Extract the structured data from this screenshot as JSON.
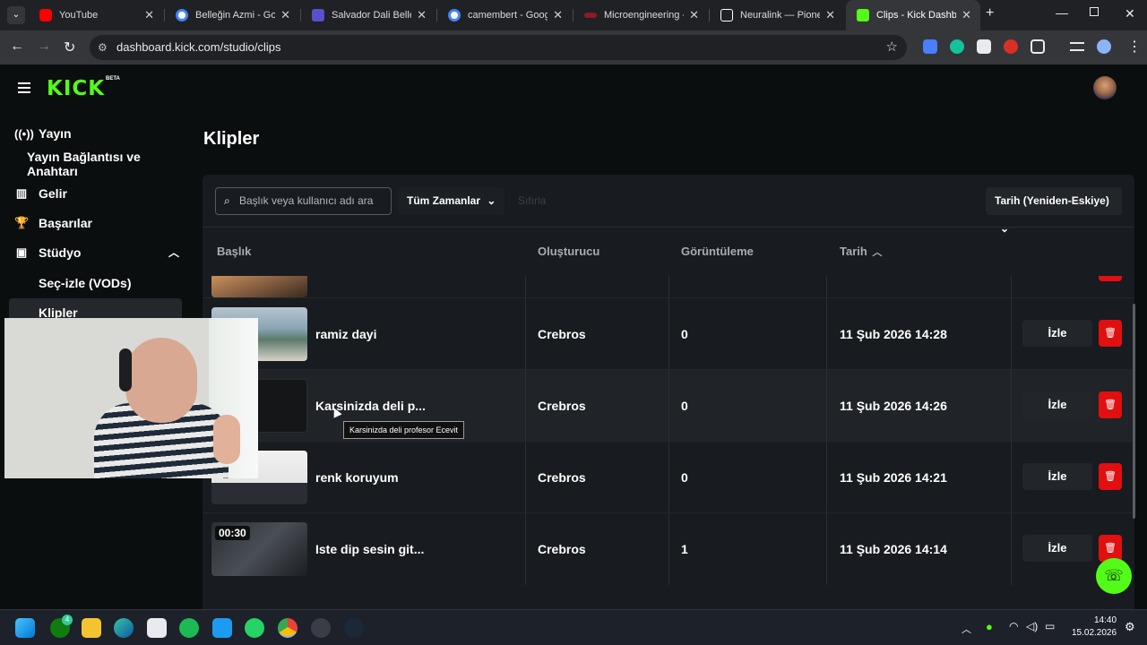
{
  "browser": {
    "tabs": [
      {
        "title": "YouTube",
        "color": "#ff0000"
      },
      {
        "title": "Belleğin Azmi - Google",
        "color": "#4285f4"
      },
      {
        "title": "Salvador Dali Belleğin",
        "color": "#5a4fcf"
      },
      {
        "title": "camembert - Google",
        "color": "#4285f4"
      },
      {
        "title": "Microengineering - ",
        "color": "#8b1a2b"
      },
      {
        "title": "Neuralink — Pioneer",
        "color": "#ffffff"
      },
      {
        "title": "Clips - Kick Dashboard",
        "color": "#53fc18"
      }
    ],
    "url": "dashboard.kick.com/studio/clips"
  },
  "brand": {
    "logo": "KICK",
    "beta": "BETA",
    "accent": "#53fc18"
  },
  "sidebar": {
    "items": [
      {
        "label": "Yayın",
        "icon": "broadcast-icon"
      },
      {
        "label": "Yayın Bağlantısı ve Anahtarı",
        "icon": ""
      },
      {
        "label": "Gelir",
        "icon": "chart-icon"
      },
      {
        "label": "Başarılar",
        "icon": "trophy-icon"
      },
      {
        "label": "Stüdyo",
        "icon": "studio-icon"
      },
      {
        "label": "Seç-izle (VODs)",
        "icon": ""
      },
      {
        "label": "Klipler",
        "icon": ""
      }
    ]
  },
  "main": {
    "title": "Klipler",
    "search_placeholder": "Başlık veya kullanıcı adı ara",
    "time_filter": "Tüm Zamanlar",
    "reset": "Sıfırla",
    "sort": "Tarih (Yeniden-Eskiye)",
    "columns": [
      "Başlık",
      "Oluşturucu",
      "Görüntüleme",
      "Tarih"
    ],
    "rows": [
      {
        "title": "ramiz dayi",
        "creator": "Crebros",
        "views": "0",
        "date": "11 Şub 2026 14:28",
        "watch": "İzle"
      },
      {
        "title": "Karsinizda deli p...",
        "creator": "Crebros",
        "views": "0",
        "date": "11 Şub 2026 14:26",
        "watch": "İzle"
      },
      {
        "title": "renk koruyum",
        "creator": "Crebros",
        "views": "0",
        "date": "11 Şub 2026 14:21",
        "watch": "İzle"
      },
      {
        "title": "Iste dip sesin git...",
        "creator": "Crebros",
        "views": "1",
        "date": "11 Şub 2026 14:14",
        "watch": "İzle",
        "duration": "00:30"
      }
    ],
    "tooltip": "Karsinizda deli profesor Ecevit"
  },
  "taskbar": {
    "time": "14:40",
    "date": "15.02.2026",
    "badge": "4"
  }
}
